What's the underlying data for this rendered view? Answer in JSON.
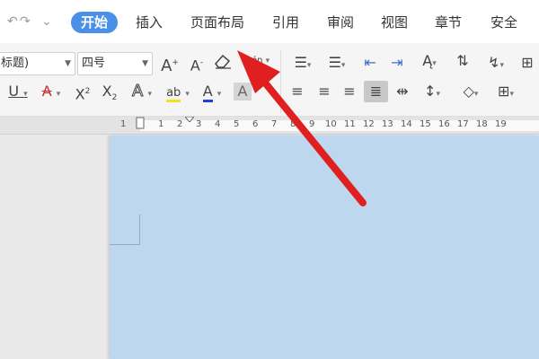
{
  "tabs": [
    {
      "label": "开始",
      "active": true
    },
    {
      "label": "插入"
    },
    {
      "label": "页面布局"
    },
    {
      "label": "引用"
    },
    {
      "label": "审阅"
    },
    {
      "label": "视图"
    },
    {
      "label": "章节"
    },
    {
      "label": "安全"
    }
  ],
  "font": {
    "style_value": "标题)",
    "size_value": "四号"
  },
  "toolbar_glyphs": {
    "grow": "A",
    "grow_sup": "+",
    "shrink": "A",
    "shrink_sup": "-",
    "pinyin": "wén",
    "underline": "U",
    "strike": "A",
    "superscript": "X",
    "superscript_mark": "2",
    "subscript": "X",
    "subscript_mark": "2",
    "effect": "A",
    "highlight": "ab",
    "font_color": "A",
    "char_shade": "A"
  },
  "ruler": {
    "numbers": [
      "1",
      "1",
      "2",
      "3",
      "4",
      "5",
      "6",
      "7",
      "8",
      "9",
      "10",
      "11",
      "12",
      "13",
      "14",
      "15",
      "16",
      "17",
      "18",
      "19"
    ]
  },
  "colors": {
    "accent": "#4a8fe8",
    "page": "#bdd7ee",
    "annotation_arrow": "#e02020",
    "highlight_bar": "#f5e01c",
    "font_color_bar": "#1f3fd6"
  }
}
